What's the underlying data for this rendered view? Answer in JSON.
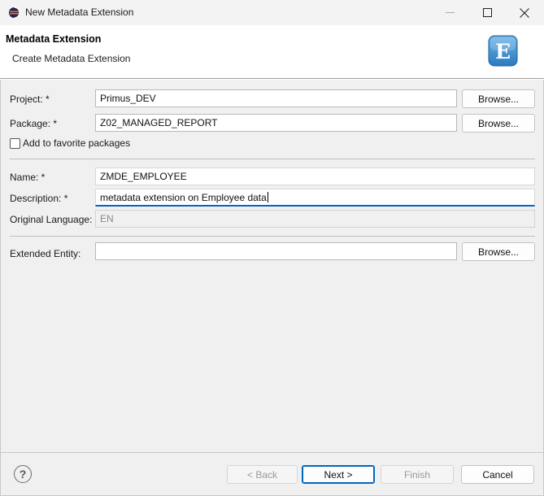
{
  "window": {
    "title": "New Metadata Extension",
    "app_icon": "eclipse-icon",
    "controls": [
      "minimize-icon",
      "maximize-icon",
      "close-icon"
    ]
  },
  "banner": {
    "title": "Metadata Extension",
    "subtitle": "Create Metadata Extension",
    "icon": "metadata-extension-E-icon",
    "icon_letter": "E"
  },
  "form": {
    "project": {
      "label": "Project: *",
      "value": "Primus_DEV",
      "browse": "Browse..."
    },
    "package": {
      "label": "Package: *",
      "value": "Z02_MANAGED_REPORT",
      "browse": "Browse..."
    },
    "favorite": {
      "label": "Add to favorite packages",
      "checked": false
    },
    "name": {
      "label": "Name: *",
      "value": "ZMDE_EMPLOYEE"
    },
    "description": {
      "label": "Description: *",
      "value": "metadata extension on Employee data"
    },
    "original_language": {
      "label": "Original Language:",
      "value": "EN"
    },
    "extended_entity": {
      "label": "Extended Entity:",
      "value": "",
      "browse": "Browse..."
    }
  },
  "footer": {
    "help_icon": "help-icon",
    "back": "< Back",
    "next": "Next >",
    "finish": "Finish",
    "cancel": "Cancel"
  },
  "colors": {
    "accent": "#0067c0",
    "banner_icon_bg": "#3b8fd0"
  }
}
